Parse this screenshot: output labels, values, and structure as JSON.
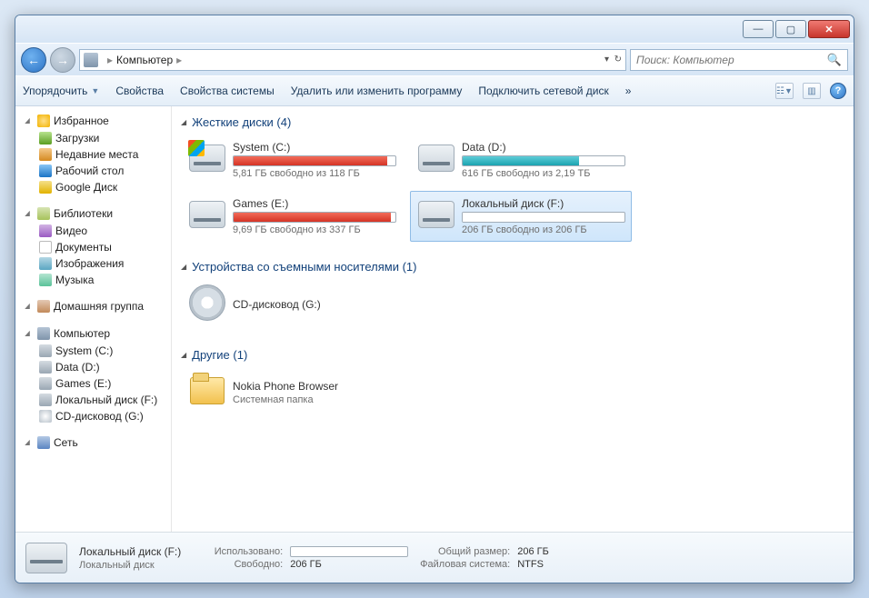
{
  "breadcrumb": {
    "root": "Компьютер"
  },
  "search": {
    "placeholder": "Поиск: Компьютер"
  },
  "toolbar": {
    "organize": "Упорядочить",
    "properties": "Свойства",
    "sysprops": "Свойства системы",
    "uninstall": "Удалить или изменить программу",
    "mapdrive": "Подключить сетевой диск",
    "overflow": "»"
  },
  "sidebar": {
    "favorites": {
      "label": "Избранное",
      "items": [
        "Загрузки",
        "Недавние места",
        "Рабочий стол",
        "Google Диск"
      ]
    },
    "libraries": {
      "label": "Библиотеки",
      "items": [
        "Видео",
        "Документы",
        "Изображения",
        "Музыка"
      ]
    },
    "homegroup": {
      "label": "Домашняя группа"
    },
    "computer": {
      "label": "Компьютер",
      "items": [
        "System (C:)",
        "Data (D:)",
        "Games (E:)",
        "Локальный диск (F:)",
        "CD-дисковод (G:)"
      ]
    },
    "network": {
      "label": "Сеть"
    }
  },
  "sections": {
    "hdd": "Жесткие диски (4)",
    "removable": "Устройства со съемными носителями (1)",
    "other": "Другие (1)"
  },
  "drives": {
    "c": {
      "name": "System (C:)",
      "sub": "5,81 ГБ свободно из 118 ГБ",
      "fill": 95
    },
    "d": {
      "name": "Data (D:)",
      "sub": "616 ГБ свободно из 2,19 ТБ",
      "fill": 72
    },
    "e": {
      "name": "Games (E:)",
      "sub": "9,69 ГБ свободно из 337 ГБ",
      "fill": 97
    },
    "f": {
      "name": "Локальный диск (F:)",
      "sub": "206 ГБ свободно из 206 ГБ",
      "fill": 2
    },
    "g": {
      "name": "CD-дисковод (G:)"
    }
  },
  "other": {
    "name": "Nokia Phone Browser",
    "sub": "Системная папка"
  },
  "footer": {
    "title": "Локальный диск (F:)",
    "type": "Локальный диск",
    "used_label": "Использовано:",
    "free_label": "Свободно:",
    "free_val": "206 ГБ",
    "total_label": "Общий размер:",
    "total_val": "206 ГБ",
    "fs_label": "Файловая система:",
    "fs_val": "NTFS"
  }
}
